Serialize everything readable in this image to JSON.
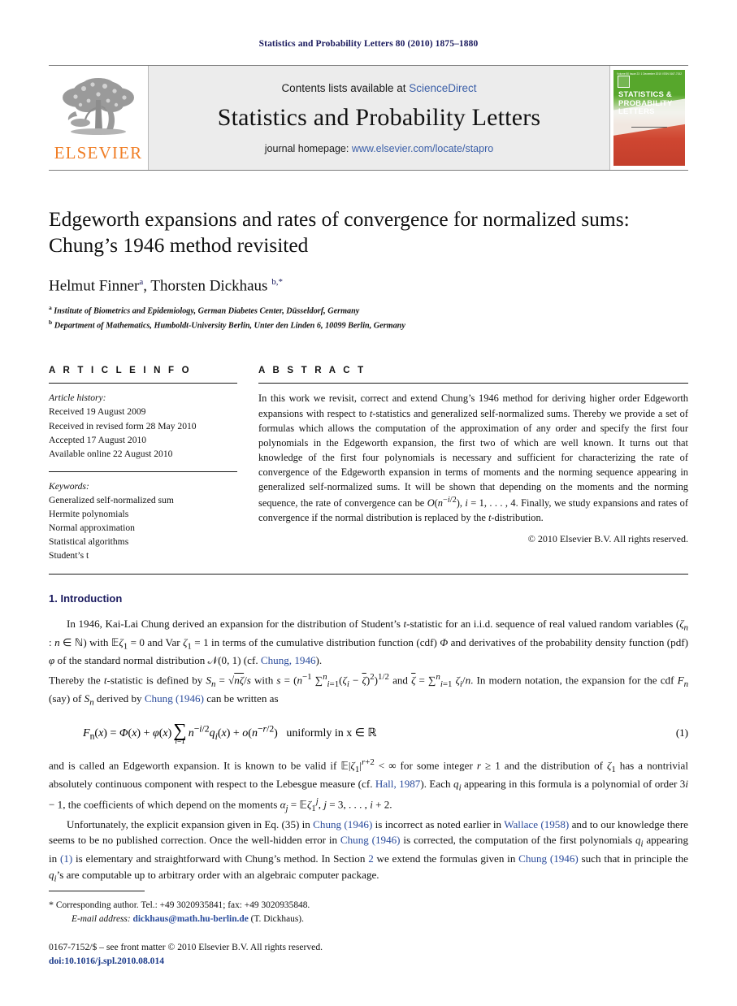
{
  "running_head": "Statistics and Probability Letters 80 (2010) 1875–1880",
  "masthead": {
    "publisher_name": "ELSEVIER",
    "contents_prefix": "Contents lists available at ",
    "contents_link": "ScienceDirect",
    "journal_title": "Statistics and Probability Letters",
    "homepage_prefix": "journal homepage: ",
    "homepage_url": "www.elsevier.com/locate/stapro",
    "cover": {
      "title": "STATISTICS & PROBABILITY LETTERS",
      "top_left": "Volume 80 Issue 23",
      "top_mid": "1 December 2010",
      "top_right": "ISSN 0167-7152"
    }
  },
  "article": {
    "title": "Edgeworth expansions and rates of convergence for normalized sums: Chung’s 1946 method revisited",
    "authors_html": "Helmut Finner<sup>a</sup>, Thorsten Dickhaus <sup>b,*</sup>",
    "affiliation_a": "Institute of Biometrics and Epidemiology, German Diabetes Center, Düsseldorf, Germany",
    "affiliation_b": "Department of Mathematics, Humboldt-University Berlin, Unter den Linden 6, 10099 Berlin, Germany"
  },
  "info": {
    "heading": "A R T I C L E   I N F O",
    "history_label": "Article history:",
    "history": [
      "Received 19 August 2009",
      "Received in revised form 28 May 2010",
      "Accepted 17 August 2010",
      "Available online 22 August 2010"
    ],
    "keywords_label": "Keywords:",
    "keywords": [
      "Generalized self-normalized sum",
      "Hermite polynomials",
      "Normal approximation",
      "Statistical algorithms",
      "Student’s t"
    ]
  },
  "abstract": {
    "heading": "A B S T R A C T",
    "text_html": "In this work we revisit, correct and extend Chung’s 1946 method for deriving higher order Edgeworth expansions with respect to <i>t</i>-statistics and generalized self-normalized sums. Thereby we provide a set of formulas which allows the computation of the approximation of any order and specify the first four polynomials in the Edgeworth expansion, the first two of which are well known. It turns out that knowledge of the first four polynomials is necessary and sufficient for characterizing the rate of convergence of the Edgeworth expansion in terms of moments and the norming sequence appearing in generalized self-normalized sums. It will be shown that depending on the moments and the norming sequence, the rate of convergence can be <i>O</i>(<i>n</i><sup>−<i>i</i>/2</sup>), <i>i</i> = 1, . . . , 4. Finally, we study expansions and rates of convergence if the normal distribution is replaced by the <i>t</i>-distribution.",
    "copyright": "© 2010 Elsevier B.V. All rights reserved."
  },
  "section": {
    "number_title": "1. Introduction",
    "p1_html": "In 1946, Kai-Lai Chung derived an expansion for the distribution of Student’s <i>t</i>-statistic for an i.i.d. sequence of real valued random variables (<i>ζ</i><sub><i>n</i></sub> : <i>n</i> ∈ ℕ) with 𝔼<i>ζ</i><sub>1</sub> = 0 and Var <i>ζ</i><sub>1</sub> = 1 in terms of the cumulative distribution function (cdf) <i>Φ</i> and derivatives of the probability density function (pdf) <i>φ</i> of the standard normal distribution 𝒩(0, 1) (cf. <span class=\"lnk\">Chung, 1946</span>).",
    "p1_cont_html": "Thereby the <i>t</i>-statistic is defined by <i>S</i><sub><i>n</i></sub> = √<span style=\"text-decoration:overline\"><i>nζ</i></span>/<i>s</i> with <i>s</i> = (<i>n</i><sup>−1</sup> ∑<sup><i>n</i></sup><sub><i>i</i>=1</sub>(<i>ζ</i><sub><i>i</i></sub> − <span style=\"text-decoration:overline\"><i>ζ</i></span>)<sup>2</sup>)<sup>1/2</sup> and <span style=\"text-decoration:overline\"><i>ζ</i></span> = ∑<sup><i>n</i></sup><sub><i>i</i>=1</sub> <i>ζ</i><sub><i>i</i></sub>/<i>n</i>. In modern notation, the expansion for the cdf <i>F</i><sub><i>n</i></sub> (say) of <i>S</i><sub><i>n</i></sub> derived by <span class=\"lnk\">Chung (1946)</span> can be written as",
    "equation_number": "(1)",
    "equation_tail": "uniformly in x ∈ ℝ",
    "p2_html": "and is called an Edgeworth expansion. It is known to be valid if 𝔼|<i>ζ</i><sub>1</sub>|<sup><i>r</i>+2</sup> &lt; ∞ for some integer <i>r</i> ≥ 1 and the distribution of <i>ζ</i><sub>1</sub> has a nontrivial absolutely continuous component with respect to the Lebesgue measure (cf. <span class=\"lnk\">Hall, 1987</span>). Each <i>q</i><sub><i>i</i></sub> appearing in this formula is a polynomial of order 3<i>i</i> − 1, the coefficients of which depend on the moments <i>α</i><sub><i>j</i></sub> = 𝔼<i>ζ</i><sub>1</sub><sup><i>j</i></sup>, <i>j</i> = 3, . . . , <i>i</i> + 2.",
    "p3_html": "Unfortunately, the explicit expansion given in Eq. (35) in <span class=\"lnk\">Chung (1946)</span> is incorrect as noted earlier in <span class=\"lnk\">Wallace (1958)</span> and to our knowledge there seems to be no published correction. Once the well-hidden error in <span class=\"lnk\">Chung (1946)</span> is corrected, the computation of the first polynomials <i>q</i><sub><i>i</i></sub> appearing in <span class=\"lnk\">(1)</span> is elementary and straightforward with Chung’s method. In Section <span class=\"lnk\">2</span> we extend the formulas given in <span class=\"lnk\">Chung (1946)</span> such that in principle the <i>q</i><sub><i>i</i></sub>’s are computable up to arbitrary order with an algebraic computer package."
  },
  "footnotes": {
    "star_marker": "*",
    "corresponding_html": "Corresponding author. Tel.: +49 3020935841; fax: +49 3020935848.",
    "email_label": "E-mail address:",
    "email": "dickhaus@math.hu-berlin.de",
    "email_suffix": "(T. Dickhaus).",
    "issn_line": "0167-7152/$ – see front matter © 2010 Elsevier B.V. All rights reserved.",
    "doi": "doi:10.1016/j.spl.2010.08.014"
  },
  "colors": {
    "link_blue": "#2a4b9b",
    "header_navy": "#1a1a5e",
    "elsevier_orange": "#f07e26",
    "masthead_grey": "#ececec"
  }
}
